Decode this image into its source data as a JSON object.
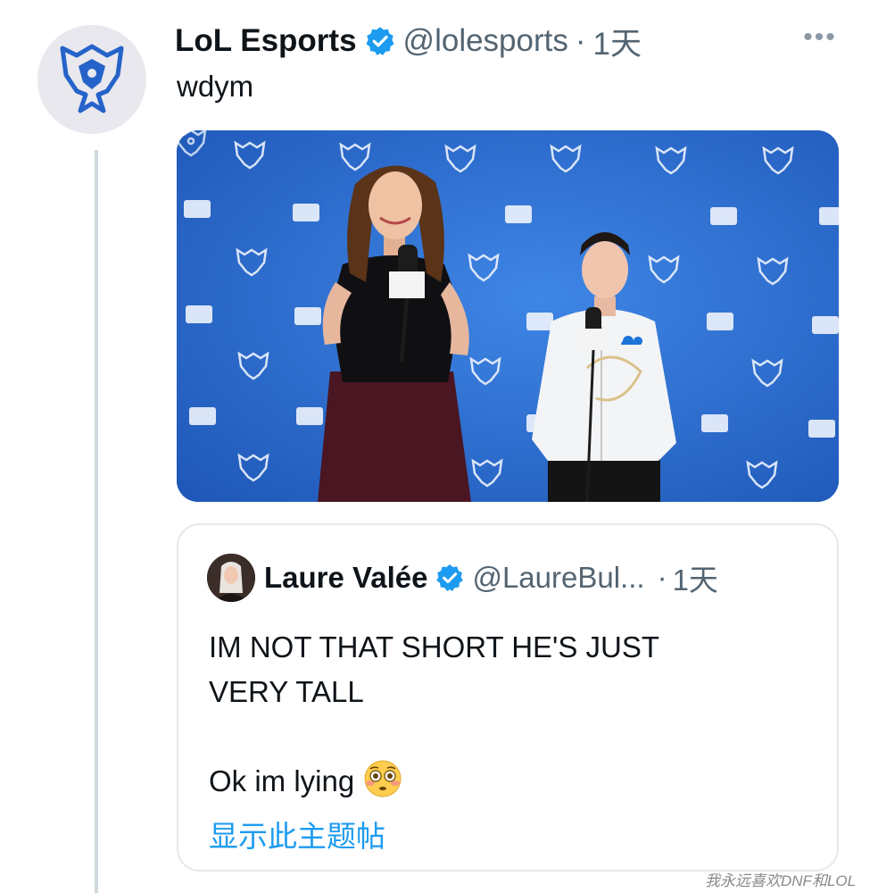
{
  "tweet": {
    "author": {
      "display_name": "LoL Esports",
      "handle": "@lolesports",
      "verified": true,
      "avatar_icon": "worlds-logo-icon"
    },
    "separator": "·",
    "time": "1天",
    "more_label": "•••",
    "text": "wdym",
    "media": {
      "icon": "press-conference-photo"
    }
  },
  "quoted_tweet": {
    "author": {
      "display_name": "Laure Valée",
      "handle": "@LaureBul...",
      "verified": true
    },
    "separator": "·",
    "time": "1天",
    "lines": [
      "IM NOT THAT SHORT HE'S JUST",
      "VERY TALL",
      "",
      "Ok im lying"
    ],
    "emoji_icon": "flushed-face-icon",
    "show_thread": "显示此主题帖"
  },
  "watermark": "我永远喜欢DNF和LOL",
  "colors": {
    "accent": "#1d9bf0",
    "secondary_text": "#536471",
    "backdrop": "#2d6fd3"
  }
}
